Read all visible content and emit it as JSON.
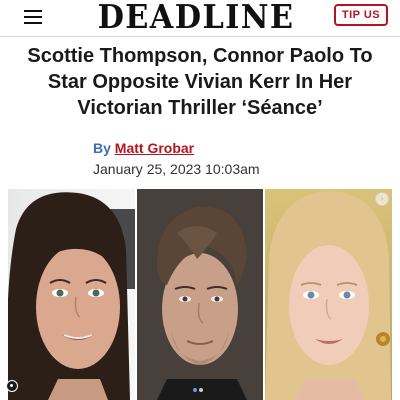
{
  "header": {
    "logo": "DEADLINE",
    "tip_button": "TIP US",
    "menu_icon": "hamburger-menu-icon"
  },
  "article": {
    "headline": "Scottie Thompson, Connor Paolo To Star Opposite Vivian Kerr In Her Victorian Thriller ‘Séance’",
    "byline_prefix": "By",
    "author": "Matt Grobar",
    "date": "January 25, 2023 10:03am"
  },
  "photos": {
    "count": 3,
    "carousel_position": 1,
    "carousel_total": 2,
    "arrow_icon": "chevron-right-icon"
  },
  "colors": {
    "accent": "#b3141f",
    "byline_blue": "#3d6fb3",
    "carousel_dot_active": "#5aa0e6"
  }
}
